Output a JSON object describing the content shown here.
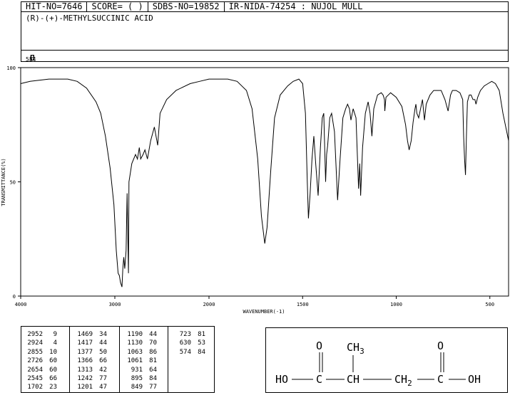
{
  "header": {
    "hit_no": "HIT-NO=7646",
    "score": "SCORE=  (   )",
    "sdbs_no": "SDBS-NO=19852",
    "ir_info": "IR-NIDA-74254 : NUJOL MULL"
  },
  "compound_name": "(R)-(+)-METHYLSUCCINIC ACID",
  "formula": {
    "c": "C",
    "c_n": "5",
    "h": "H",
    "h_n": "8",
    "o": "O",
    "o_n": "4"
  },
  "structure": {
    "o_left": "O",
    "o_right": "O",
    "ch3": "CH",
    "ch3_n": "3",
    "ho": "HO",
    "c1": "C",
    "ch": "CH",
    "ch2": "CH",
    "ch2_n": "2",
    "c2": "C",
    "oh": "OH"
  },
  "peak_table": {
    "col1": [
      [
        "2952",
        "9"
      ],
      [
        "2924",
        "4"
      ],
      [
        "2855",
        "10"
      ],
      [
        "2726",
        "60"
      ],
      [
        "2654",
        "60"
      ],
      [
        "2545",
        "66"
      ],
      [
        "1702",
        "23"
      ]
    ],
    "col2": [
      [
        "1469",
        "34"
      ],
      [
        "1417",
        "44"
      ],
      [
        "1377",
        "50"
      ],
      [
        "1366",
        "66"
      ],
      [
        "1313",
        "42"
      ],
      [
        "1242",
        "77"
      ],
      [
        "1201",
        "47"
      ]
    ],
    "col3": [
      [
        "1190",
        "44"
      ],
      [
        "1130",
        "70"
      ],
      [
        "1063",
        "86"
      ],
      [
        "1061",
        "81"
      ],
      [
        "931",
        "64"
      ],
      [
        "895",
        "84"
      ],
      [
        "849",
        "77"
      ]
    ],
    "col4": [
      [
        "723",
        "81"
      ],
      [
        "630",
        "53"
      ],
      [
        "574",
        "84"
      ]
    ]
  },
  "chart_data": {
    "type": "line",
    "xlabel": "WAVENUMBER(-1)",
    "ylabel": "TRANSMITTANCE(%)",
    "xlim": [
      4000,
      400
    ],
    "ylim": [
      0,
      100
    ],
    "xticks": [
      4000,
      3000,
      2000,
      1500,
      1000,
      500
    ],
    "yticks": [
      0,
      50,
      100
    ],
    "grid": false,
    "series": [
      {
        "points": [
          [
            4000,
            93
          ],
          [
            3900,
            94
          ],
          [
            3700,
            95
          ],
          [
            3500,
            95
          ],
          [
            3400,
            94
          ],
          [
            3300,
            91
          ],
          [
            3200,
            85
          ],
          [
            3150,
            80
          ],
          [
            3100,
            70
          ],
          [
            3050,
            56
          ],
          [
            3010,
            40
          ],
          [
            2985,
            20
          ],
          [
            2965,
            10
          ],
          [
            2952,
            9
          ],
          [
            2940,
            6
          ],
          [
            2924,
            4
          ],
          [
            2915,
            12
          ],
          [
            2905,
            17
          ],
          [
            2895,
            12
          ],
          [
            2880,
            20
          ],
          [
            2870,
            45
          ],
          [
            2855,
            10
          ],
          [
            2850,
            50
          ],
          [
            2820,
            58
          ],
          [
            2780,
            62
          ],
          [
            2760,
            60
          ],
          [
            2740,
            65
          ],
          [
            2726,
            60
          ],
          [
            2700,
            62
          ],
          [
            2680,
            64
          ],
          [
            2654,
            60
          ],
          [
            2620,
            68
          ],
          [
            2580,
            74
          ],
          [
            2545,
            66
          ],
          [
            2520,
            80
          ],
          [
            2450,
            86
          ],
          [
            2350,
            90
          ],
          [
            2200,
            93
          ],
          [
            2100,
            94
          ],
          [
            2000,
            95
          ],
          [
            1900,
            95
          ],
          [
            1850,
            94
          ],
          [
            1800,
            90
          ],
          [
            1770,
            82
          ],
          [
            1740,
            60
          ],
          [
            1720,
            35
          ],
          [
            1702,
            23
          ],
          [
            1690,
            30
          ],
          [
            1670,
            55
          ],
          [
            1650,
            78
          ],
          [
            1620,
            88
          ],
          [
            1580,
            92
          ],
          [
            1550,
            94
          ],
          [
            1520,
            95
          ],
          [
            1500,
            93
          ],
          [
            1485,
            80
          ],
          [
            1475,
            50
          ],
          [
            1469,
            34
          ],
          [
            1460,
            45
          ],
          [
            1450,
            60
          ],
          [
            1440,
            70
          ],
          [
            1430,
            58
          ],
          [
            1417,
            44
          ],
          [
            1405,
            65
          ],
          [
            1395,
            78
          ],
          [
            1387,
            80
          ],
          [
            1377,
            50
          ],
          [
            1372,
            62
          ],
          [
            1366,
            66
          ],
          [
            1355,
            78
          ],
          [
            1345,
            80
          ],
          [
            1330,
            72
          ],
          [
            1313,
            42
          ],
          [
            1300,
            60
          ],
          [
            1285,
            78
          ],
          [
            1270,
            82
          ],
          [
            1260,
            84
          ],
          [
            1250,
            82
          ],
          [
            1242,
            77
          ],
          [
            1230,
            82
          ],
          [
            1215,
            78
          ],
          [
            1201,
            47
          ],
          [
            1195,
            58
          ],
          [
            1190,
            44
          ],
          [
            1180,
            65
          ],
          [
            1165,
            80
          ],
          [
            1150,
            85
          ],
          [
            1140,
            80
          ],
          [
            1130,
            70
          ],
          [
            1120,
            82
          ],
          [
            1100,
            88
          ],
          [
            1080,
            89
          ],
          [
            1070,
            88
          ],
          [
            1063,
            86
          ],
          [
            1061,
            81
          ],
          [
            1055,
            87
          ],
          [
            1030,
            89
          ],
          [
            1000,
            87
          ],
          [
            970,
            83
          ],
          [
            950,
            75
          ],
          [
            940,
            68
          ],
          [
            931,
            64
          ],
          [
            920,
            68
          ],
          [
            910,
            76
          ],
          [
            900,
            82
          ],
          [
            895,
            84
          ],
          [
            890,
            80
          ],
          [
            880,
            78
          ],
          [
            870,
            82
          ],
          [
            860,
            86
          ],
          [
            849,
            77
          ],
          [
            840,
            84
          ],
          [
            820,
            88
          ],
          [
            800,
            90
          ],
          [
            760,
            90
          ],
          [
            740,
            86
          ],
          [
            723,
            81
          ],
          [
            710,
            88
          ],
          [
            700,
            90
          ],
          [
            680,
            90
          ],
          [
            660,
            89
          ],
          [
            645,
            86
          ],
          [
            640,
            70
          ],
          [
            635,
            60
          ],
          [
            630,
            53
          ],
          [
            625,
            70
          ],
          [
            620,
            85
          ],
          [
            610,
            88
          ],
          [
            600,
            88
          ],
          [
            590,
            86
          ],
          [
            580,
            86
          ],
          [
            574,
            84
          ],
          [
            565,
            87
          ],
          [
            550,
            90
          ],
          [
            530,
            92
          ],
          [
            510,
            93
          ],
          [
            490,
            94
          ],
          [
            470,
            93
          ],
          [
            450,
            90
          ],
          [
            430,
            80
          ],
          [
            410,
            72
          ],
          [
            400,
            68
          ]
        ]
      }
    ]
  }
}
